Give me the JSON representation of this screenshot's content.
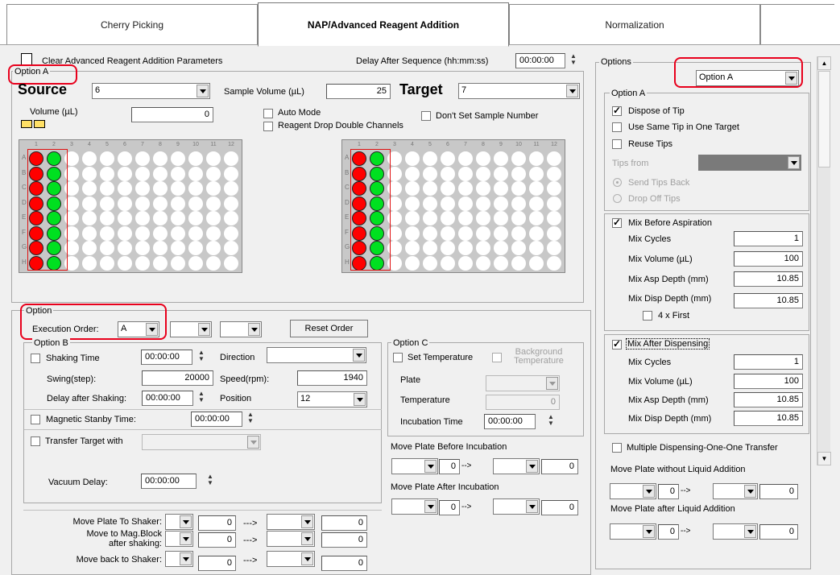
{
  "tabs": [
    {
      "label": "Cherry Picking"
    },
    {
      "label": "NAP/Advanced Reagent Addition"
    },
    {
      "label": "Normalization"
    }
  ],
  "top": {
    "clear_label": "Clear Advanced Reagent Addition Parameters",
    "delay_label": "Delay After Sequence (hh:mm:ss)",
    "delay_value": "00:00:00"
  },
  "optionA_box": {
    "title": "Option A"
  },
  "source": {
    "label": "Source",
    "value": "6",
    "sample_volume_label": "Sample Volume (µL)",
    "sample_volume": "25"
  },
  "target": {
    "label": "Target",
    "value": "7"
  },
  "volume": {
    "label": "Volume (µL)",
    "value": "0"
  },
  "checks": {
    "auto_mode": "Auto Mode",
    "reagent_drop": "Reagent Drop Double Channels",
    "dont_set": "Don't Set Sample Number"
  },
  "plate": {
    "columns": [
      "1",
      "2",
      "3",
      "4",
      "5",
      "6",
      "7",
      "8",
      "9",
      "10",
      "11",
      "12"
    ],
    "rows": [
      "A",
      "B",
      "C",
      "D",
      "E",
      "F",
      "G",
      "H"
    ],
    "red_col": 1,
    "green_col": 2,
    "red_color": "#ff0000",
    "green_color": "#00e020",
    "highlight_color": "#e01010"
  },
  "option": {
    "title": "Option",
    "exec_label": "Execution Order:",
    "exec_value": "A",
    "reset_label": "Reset Order"
  },
  "optionB": {
    "title": "Option B",
    "shaking_label": "Shaking Time",
    "shaking_value": "00:00:00",
    "direction_label": "Direction",
    "direction_value": "",
    "swing_label": "Swing(step):",
    "swing_value": "20000",
    "speed_label": "Speed(rpm):",
    "speed_value": "1940",
    "delay_label": "Delay after Shaking:",
    "delay_value": "00:00:00",
    "position_label": "Position",
    "position_value": "12",
    "magnetic_label": "Magnetic Stanby Time:",
    "magnetic_value": "00:00:00",
    "transfer_label": "Transfer Target with",
    "vacuum_label": "Vacuum Delay:",
    "vacuum_value": "00:00:00"
  },
  "moves_left": [
    {
      "label": "Move Plate To Shaker:",
      "a": "0",
      "b": "0"
    },
    {
      "label": "Move to Mag.Block\nafter shaking:",
      "a": "0",
      "b": "0"
    },
    {
      "label": "Move back to Shaker:",
      "a": "0",
      "b": "0"
    }
  ],
  "arrow_text": "--->",
  "optionC": {
    "title": "Option C",
    "set_temp_label": "Set Temperature",
    "bg_temp_label": "Background Temperature",
    "plate_label": "Plate",
    "temp_label": "Temperature",
    "temp_value": "0",
    "incubation_label": "Incubation Time",
    "incubation_value": "00:00:00",
    "move_before_label": "Move Plate Before Incubation",
    "move_after_label": "Move Plate After Incubation",
    "v1": "0",
    "v2": "0",
    "v3": "0",
    "v4": "0"
  },
  "mini_arrow": "-->",
  "options_panel": {
    "title": "Options",
    "select_value": "Option A",
    "group_title": "Option A",
    "dispose_label": "Dispose of Tip",
    "same_tip_label": "Use Same Tip in One Target",
    "reuse_label": "Reuse Tips",
    "tips_from_label": "Tips from",
    "send_back_label": "Send Tips Back",
    "drop_off_label": "Drop Off Tips",
    "mix_before_label": "Mix Before Aspiration",
    "mix_after_label": "Mix After Dispensing",
    "mix_cycles_label": "Mix Cycles",
    "mix_volume_label": "Mix Volume (µL)",
    "mix_asp_label": "Mix Asp Depth (mm)",
    "mix_disp_label": "Mix Disp Depth (mm)",
    "before": {
      "cycles": "1",
      "volume": "100",
      "asp": "10.85",
      "disp": "10.85"
    },
    "four_first_label": "4 x First",
    "after": {
      "cycles": "1",
      "volume": "100",
      "asp": "10.85",
      "disp": "10.85"
    },
    "multi_label": "Multiple Dispensing-One-One Transfer",
    "move_without_label": "Move Plate without Liquid Addition",
    "move_after_label": "Move Plate after Liquid Addition",
    "w1": "0",
    "w2": "0",
    "a1": "0",
    "a2": "0"
  }
}
